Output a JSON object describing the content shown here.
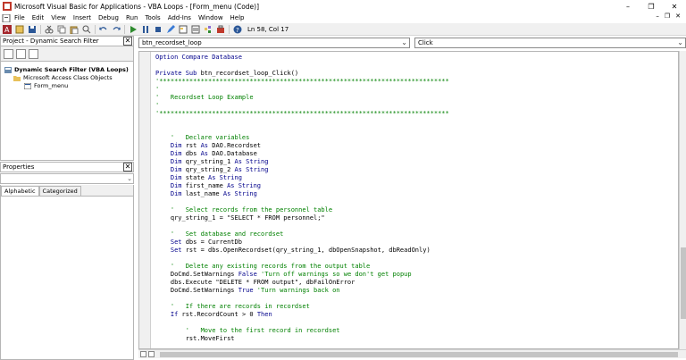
{
  "window": {
    "title": "Microsoft Visual Basic for Applications - VBA Loops - [Form_menu (Code)]",
    "controls": [
      "–",
      "❐",
      "✕"
    ]
  },
  "menubar": {
    "items": [
      "File",
      "Edit",
      "View",
      "Insert",
      "Debug",
      "Run",
      "Tools",
      "Add-Ins",
      "Window",
      "Help"
    ],
    "mdi_controls": [
      "–",
      "❐",
      "✕"
    ]
  },
  "toolbar": {
    "position": "Ln 58, Col 17"
  },
  "project": {
    "title": "Project - Dynamic Search Filter",
    "close": "✕",
    "tree": [
      {
        "label": "Dynamic Search Filter (VBA Loops)",
        "level": 0,
        "bold": true
      },
      {
        "label": "Microsoft Access Class Objects",
        "level": 1,
        "bold": false
      },
      {
        "label": "Form_menu",
        "level": 2,
        "bold": false
      }
    ]
  },
  "properties": {
    "title": "Properties",
    "close": "✕",
    "tabs": [
      "Alphabetic",
      "Categorized"
    ]
  },
  "code": {
    "object": "btn_recordset_loop",
    "procedure": "Click",
    "lines": [
      [
        [
          "kw",
          "Option Compare Database"
        ]
      ],
      [
        [
          "tx",
          ""
        ]
      ],
      [
        [
          "kw",
          "Private Sub "
        ],
        [
          "tx",
          "btn_recordset_loop_Click()"
        ]
      ],
      [
        [
          "cm",
          "'*****************************************************************************"
        ]
      ],
      [
        [
          "cm",
          "'"
        ]
      ],
      [
        [
          "cm",
          "'   Recordset Loop Example"
        ]
      ],
      [
        [
          "cm",
          "'"
        ]
      ],
      [
        [
          "cm",
          "'*****************************************************************************"
        ]
      ],
      [
        [
          "tx",
          ""
        ]
      ],
      [
        [
          "tx",
          ""
        ]
      ],
      [
        [
          "cm",
          "    '   Declare variables"
        ]
      ],
      [
        [
          "kw",
          "    Dim "
        ],
        [
          "tx",
          "rst "
        ],
        [
          "kw",
          "As "
        ],
        [
          "tx",
          "DAO.Recordset"
        ]
      ],
      [
        [
          "kw",
          "    Dim "
        ],
        [
          "tx",
          "dbs "
        ],
        [
          "kw",
          "As "
        ],
        [
          "tx",
          "DAO.Database"
        ]
      ],
      [
        [
          "kw",
          "    Dim "
        ],
        [
          "tx",
          "qry_string_1 "
        ],
        [
          "kw",
          "As String"
        ]
      ],
      [
        [
          "kw",
          "    Dim "
        ],
        [
          "tx",
          "qry_string_2 "
        ],
        [
          "kw",
          "As String"
        ]
      ],
      [
        [
          "kw",
          "    Dim "
        ],
        [
          "tx",
          "state "
        ],
        [
          "kw",
          "As String"
        ]
      ],
      [
        [
          "kw",
          "    Dim "
        ],
        [
          "tx",
          "first_name "
        ],
        [
          "kw",
          "As String"
        ]
      ],
      [
        [
          "kw",
          "    Dim "
        ],
        [
          "tx",
          "last_name "
        ],
        [
          "kw",
          "As String"
        ]
      ],
      [
        [
          "tx",
          ""
        ]
      ],
      [
        [
          "cm",
          "    '   Select records from the personnel table"
        ]
      ],
      [
        [
          "tx",
          "    qry_string_1 = \"SELECT * FROM personnel;\""
        ]
      ],
      [
        [
          "tx",
          ""
        ]
      ],
      [
        [
          "cm",
          "    '   Set database and recordset"
        ]
      ],
      [
        [
          "kw",
          "    Set "
        ],
        [
          "tx",
          "dbs = CurrentDb"
        ]
      ],
      [
        [
          "kw",
          "    Set "
        ],
        [
          "tx",
          "rst = dbs.OpenRecordset(qry_string_1, dbOpenSnapshot, dbReadOnly)"
        ]
      ],
      [
        [
          "tx",
          ""
        ]
      ],
      [
        [
          "cm",
          "    '   Delete any existing records from the output table"
        ]
      ],
      [
        [
          "tx",
          "    DoCmd.SetWarnings "
        ],
        [
          "kw",
          "False "
        ],
        [
          "cm",
          "'Turn off warnings so we don't get popup"
        ]
      ],
      [
        [
          "tx",
          "    dbs.Execute \"DELETE * FROM output\", dbFailOnError"
        ]
      ],
      [
        [
          "tx",
          "    DoCmd.SetWarnings "
        ],
        [
          "kw",
          "True "
        ],
        [
          "cm",
          "'Turn warnings back on"
        ]
      ],
      [
        [
          "tx",
          ""
        ]
      ],
      [
        [
          "cm",
          "    '   If there are records in recordset"
        ]
      ],
      [
        [
          "kw",
          "    If "
        ],
        [
          "tx",
          "rst.RecordCount > 0 "
        ],
        [
          "kw",
          "Then"
        ]
      ],
      [
        [
          "tx",
          ""
        ]
      ],
      [
        [
          "cm",
          "        '   Move to the first record in recordset"
        ]
      ],
      [
        [
          "tx",
          "        rst.MoveFirst"
        ]
      ]
    ]
  },
  "colors": {
    "keyword": "#00008b",
    "comment": "#008000",
    "text": "#000000"
  }
}
